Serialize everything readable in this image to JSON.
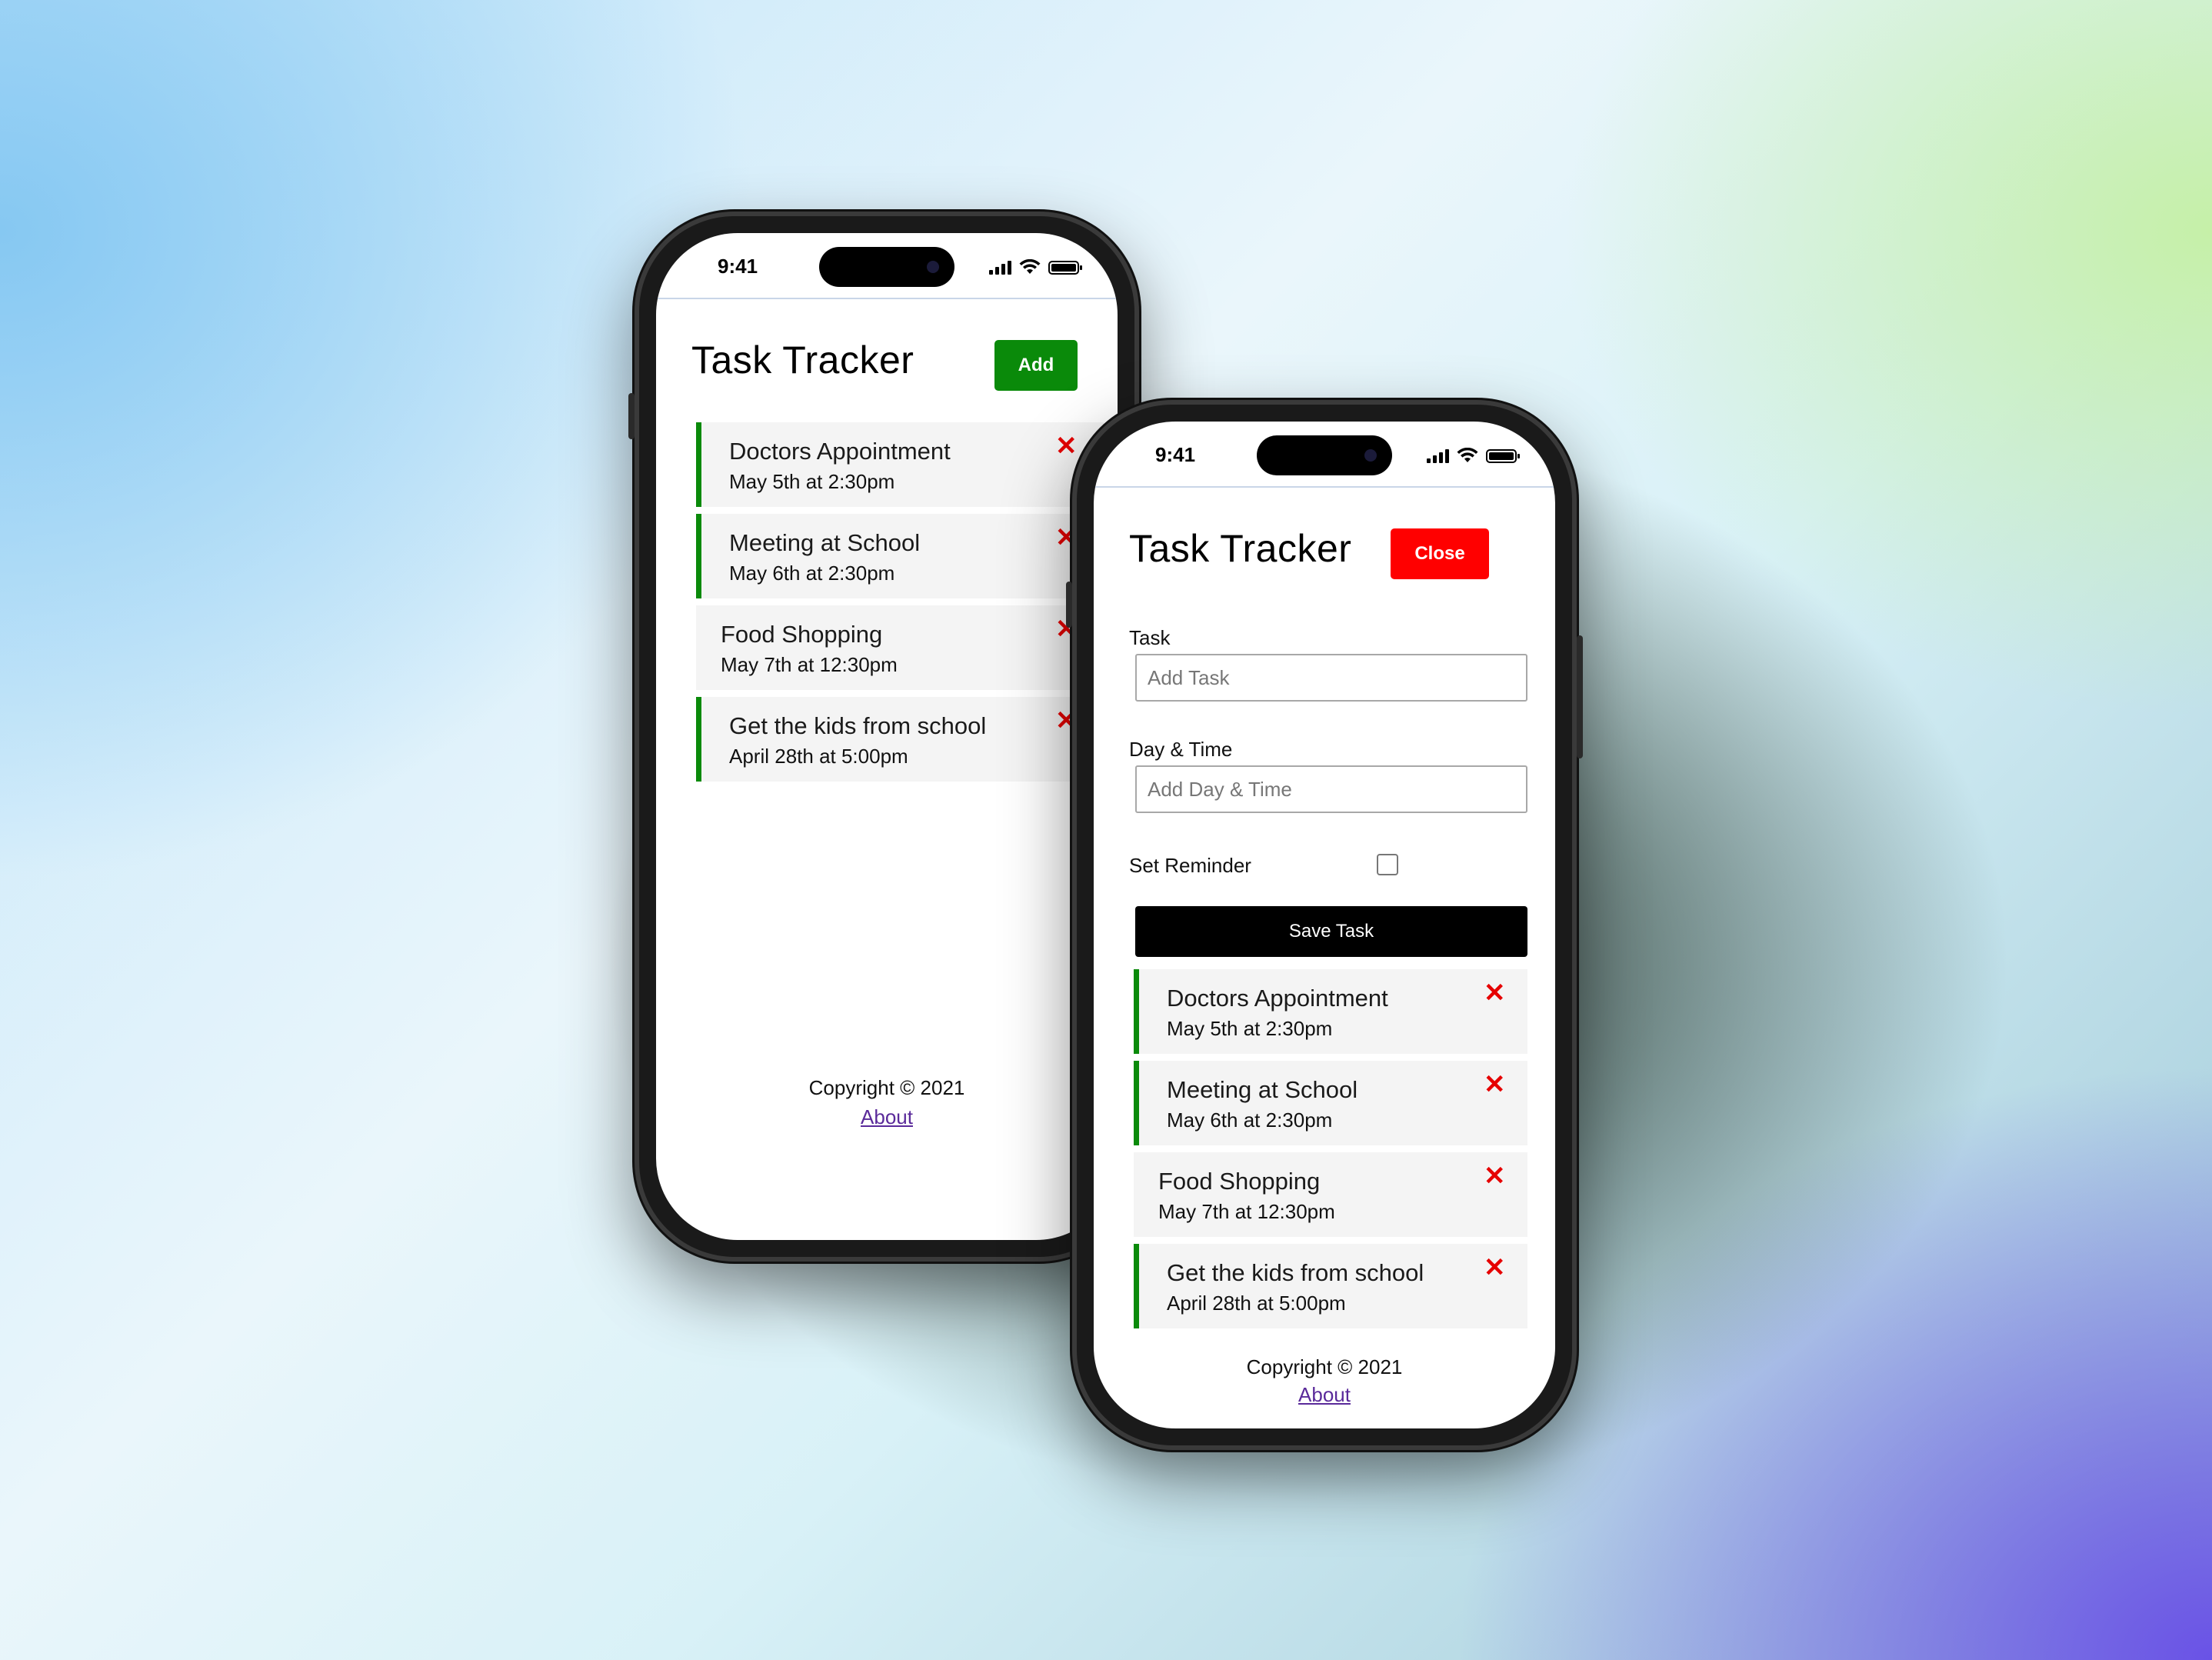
{
  "status_bar": {
    "time": "9:41"
  },
  "phone_left": {
    "title": "Task Tracker",
    "toggle_button": {
      "label": "Add",
      "color": "#0a8a0a"
    },
    "tasks": [
      {
        "text": "Doctors Appointment",
        "day": "May 5th at 2:30pm",
        "reminder": true
      },
      {
        "text": "Meeting at School",
        "day": "May 6th at 2:30pm",
        "reminder": true
      },
      {
        "text": "Food Shopping",
        "day": "May 7th at 12:30pm",
        "reminder": false
      },
      {
        "text": "Get the kids from school",
        "day": "April 28th at 5:00pm",
        "reminder": true
      }
    ],
    "delete_icon": "✕",
    "footer": {
      "copyright": "Copyright © 2021",
      "about": "About"
    }
  },
  "phone_right": {
    "title": "Task Tracker",
    "toggle_button": {
      "label": "Close",
      "color": "#ff0000"
    },
    "form": {
      "task_label": "Task",
      "task_placeholder": "Add Task",
      "day_label": "Day & Time",
      "day_placeholder": "Add Day & Time",
      "reminder_label": "Set Reminder",
      "reminder_checked": false,
      "save_label": "Save Task"
    },
    "tasks": [
      {
        "text": "Doctors Appointment",
        "day": "May 5th at 2:30pm",
        "reminder": true
      },
      {
        "text": "Meeting at School",
        "day": "May 6th at 2:30pm",
        "reminder": true
      },
      {
        "text": "Food Shopping",
        "day": "May 7th at 12:30pm",
        "reminder": false
      },
      {
        "text": "Get the kids from school",
        "day": "April 28th at 5:00pm",
        "reminder": true
      }
    ],
    "delete_icon": "✕",
    "footer": {
      "copyright": "Copyright © 2021",
      "about": "About"
    }
  },
  "colors": {
    "reminder_border": "#0a8a0a",
    "delete": "#e60000",
    "save_button": "#000000"
  }
}
